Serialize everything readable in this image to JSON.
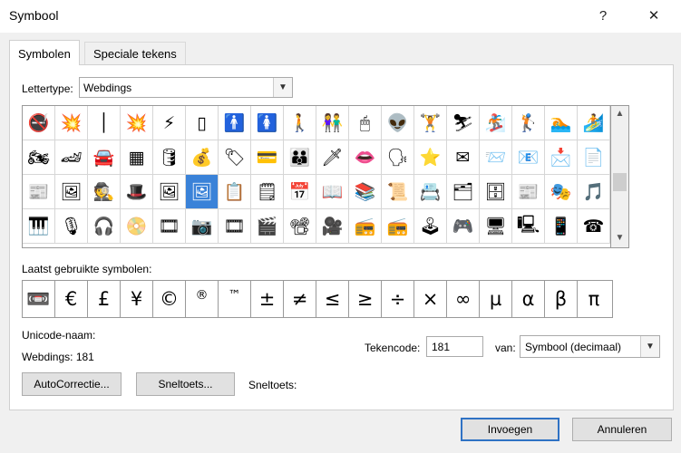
{
  "window": {
    "title": "Symbool",
    "help_glyph": "?",
    "close_glyph": "✕"
  },
  "tabs": [
    {
      "label": "Symbolen",
      "active": true
    },
    {
      "label": "Speciale tekens",
      "active": false
    }
  ],
  "font": {
    "label": "Lettertype:",
    "value": "Webdings"
  },
  "symbol_grid": {
    "selected_index": 41,
    "selected_color": "#3a82d8",
    "rows": [
      [
        "🚭",
        "💥",
        "│",
        "💥",
        "⚡",
        "▯",
        "🚹",
        "🚺",
        "🚶",
        "👫",
        "🖱",
        "👽",
        "🏋",
        "⛷",
        "🏂",
        "🏌",
        "🏊",
        "🏄"
      ],
      [
        "🏍",
        "🏎",
        "🚘",
        "▦",
        "🛢",
        "💰",
        "🏷",
        "💳",
        "👪",
        "🗡",
        "👄",
        "🗣",
        "⭐",
        "✉",
        "📨",
        "📧",
        "📩",
        "📄"
      ],
      [
        "📰",
        "🖼",
        "🕵",
        "🎩",
        "🖼",
        "🖼",
        "📋",
        "🗒",
        "📅",
        "📖",
        "📚",
        "📜",
        "📇",
        "🗂",
        "🗄",
        "📰",
        "🎭",
        "🎵"
      ],
      [
        "🎹",
        "🎙",
        "🎧",
        "📀",
        "🎞",
        "📷",
        "🎞",
        "🎬",
        "📽",
        "🎥",
        "📻",
        "📻",
        "🕹",
        "🎮",
        "🖥",
        "🖳",
        "📱",
        "☎"
      ]
    ]
  },
  "recent": {
    "label": "Laatst gebruikte symbolen:",
    "symbols": [
      "📼",
      "€",
      "£",
      "¥",
      "©",
      "®",
      "™",
      "±",
      "≠",
      "≤",
      "≥",
      "÷",
      "×",
      "∞",
      "µ",
      "α",
      "β",
      "π"
    ]
  },
  "unicode_name_label": "Unicode-naam:",
  "font_code_text": "Webdings: 181",
  "char_code": {
    "label": "Tekencode:",
    "value": "181"
  },
  "from": {
    "label": "van:",
    "value": "Symbool (decimaal)"
  },
  "buttons": {
    "autocorrect": "AutoCorrectie...",
    "shortcut_key": "Sneltoets...",
    "shortcut_label": "Sneltoets:",
    "insert": "Invoegen",
    "cancel": "Annuleren"
  },
  "icons": [
    "chevron-down-icon",
    "scroll-up-icon",
    "scroll-down-icon",
    "close-icon",
    "help-icon"
  ]
}
